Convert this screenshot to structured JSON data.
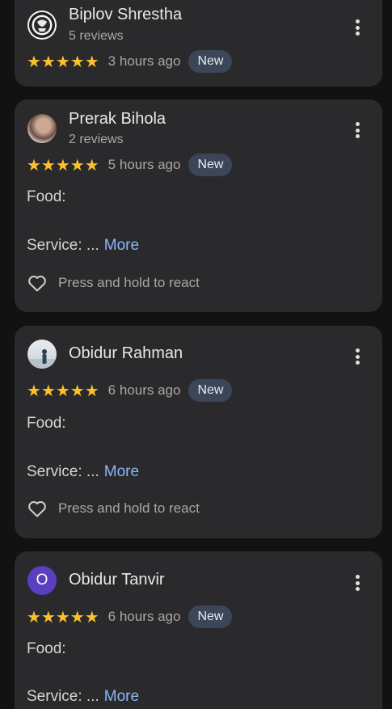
{
  "reviews": [
    {
      "name": "Biplov Shrestha",
      "review_count": "5 reviews",
      "stars": "★★★★★",
      "time": "3 hours ago",
      "badge": "New",
      "avatar_icon": "logo-avatar-icon"
    },
    {
      "name": "Prerak Bihola",
      "review_count": "2 reviews",
      "stars": "★★★★★",
      "time": "5 hours ago",
      "badge": "New",
      "food_label": "Food:",
      "service_label": "Service: ...",
      "more_label": "More",
      "react_label": "Press and hold to react"
    },
    {
      "name": "Obidur Rahman",
      "stars": "★★★★★",
      "time": "6 hours ago",
      "badge": "New",
      "food_label": "Food:",
      "service_label": "Service: ...",
      "more_label": "More",
      "react_label": "Press and hold to react"
    },
    {
      "name": "Obidur Tanvir",
      "avatar_letter": "O",
      "stars": "★★★★★",
      "time": "6 hours ago",
      "badge": "New",
      "food_label": "Food:",
      "service_label": "Service: ...",
      "more_label": "More"
    }
  ],
  "colors": {
    "background": "#121212",
    "card": "#2a2a2c",
    "star": "#fbc02d",
    "link": "#8ab4f8",
    "badge_bg": "#3b4658",
    "letter_avatar": "#5a3fc0"
  },
  "icons": [
    "more-vert-icon",
    "heart-outline-icon",
    "star-icon"
  ]
}
